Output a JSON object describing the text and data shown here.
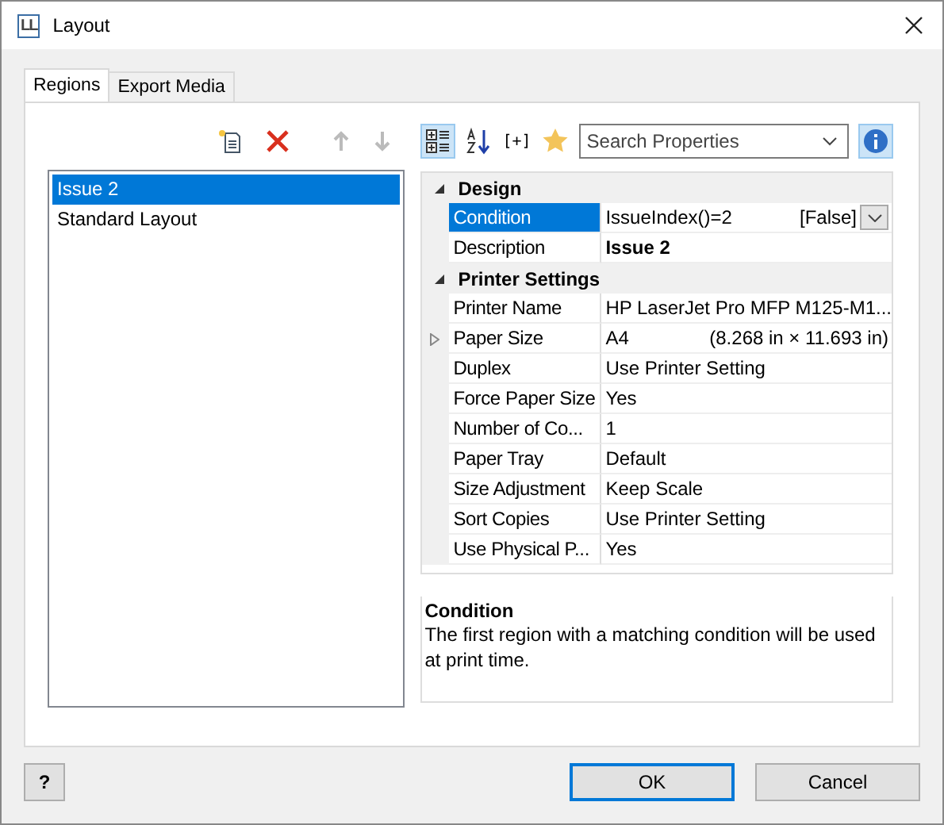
{
  "window": {
    "logo": "LL",
    "title": "Layout"
  },
  "tabs": [
    {
      "label": "Regions",
      "selected": true
    },
    {
      "label": "Export Media",
      "selected": false
    }
  ],
  "regions": {
    "items": [
      {
        "label": "Issue 2",
        "selected": true
      },
      {
        "label": "Standard Layout",
        "selected": false
      }
    ]
  },
  "properties": {
    "toolbar": {
      "categorized_selected": true,
      "expression_label": "[+]",
      "search": {
        "placeholder": "Search Properties"
      },
      "info_selected": true
    },
    "groups": [
      {
        "title": "Design",
        "expanded": true,
        "rows": [
          {
            "name": "Condition",
            "value": "IssueIndex()=2",
            "extra": "[False]",
            "selected": true,
            "bold": false,
            "expandable": false,
            "dropdown": true
          },
          {
            "name": "Description",
            "value": "Issue 2",
            "selected": false,
            "bold": true,
            "expandable": false,
            "dropdown": false
          }
        ]
      },
      {
        "title": "Printer Settings",
        "expanded": true,
        "rows": [
          {
            "name": "Printer Name",
            "value": "HP LaserJet Pro MFP M125-M1...",
            "selected": false,
            "bold": false,
            "expandable": false,
            "dropdown": false
          },
          {
            "name": "Paper Size",
            "value": "A4",
            "extra": "(8.268 in × 11.693 in)",
            "selected": false,
            "bold": false,
            "expandable": true,
            "dropdown": false
          },
          {
            "name": "Duplex",
            "value": "Use Printer Setting",
            "selected": false,
            "bold": false,
            "expandable": false,
            "dropdown": false
          },
          {
            "name": "Force Paper Size",
            "value": "Yes",
            "selected": false,
            "bold": false,
            "expandable": false,
            "dropdown": false
          },
          {
            "name": "Number of Co...",
            "value": "1",
            "selected": false,
            "bold": false,
            "expandable": false,
            "dropdown": false
          },
          {
            "name": "Paper Tray",
            "value": "Default",
            "selected": false,
            "bold": false,
            "expandable": false,
            "dropdown": false
          },
          {
            "name": "Size Adjustment",
            "value": "Keep Scale",
            "selected": false,
            "bold": false,
            "expandable": false,
            "dropdown": false
          },
          {
            "name": "Sort Copies",
            "value": "Use Printer Setting",
            "selected": false,
            "bold": false,
            "expandable": false,
            "dropdown": false
          },
          {
            "name": "Use Physical P...",
            "value": "Yes",
            "selected": false,
            "bold": false,
            "expandable": false,
            "dropdown": false
          }
        ]
      }
    ],
    "description": {
      "title": "Condition",
      "text": "The first region with a matching condition will be used at print time."
    }
  },
  "buttons": {
    "help": "?",
    "ok": "OK",
    "cancel": "Cancel"
  }
}
